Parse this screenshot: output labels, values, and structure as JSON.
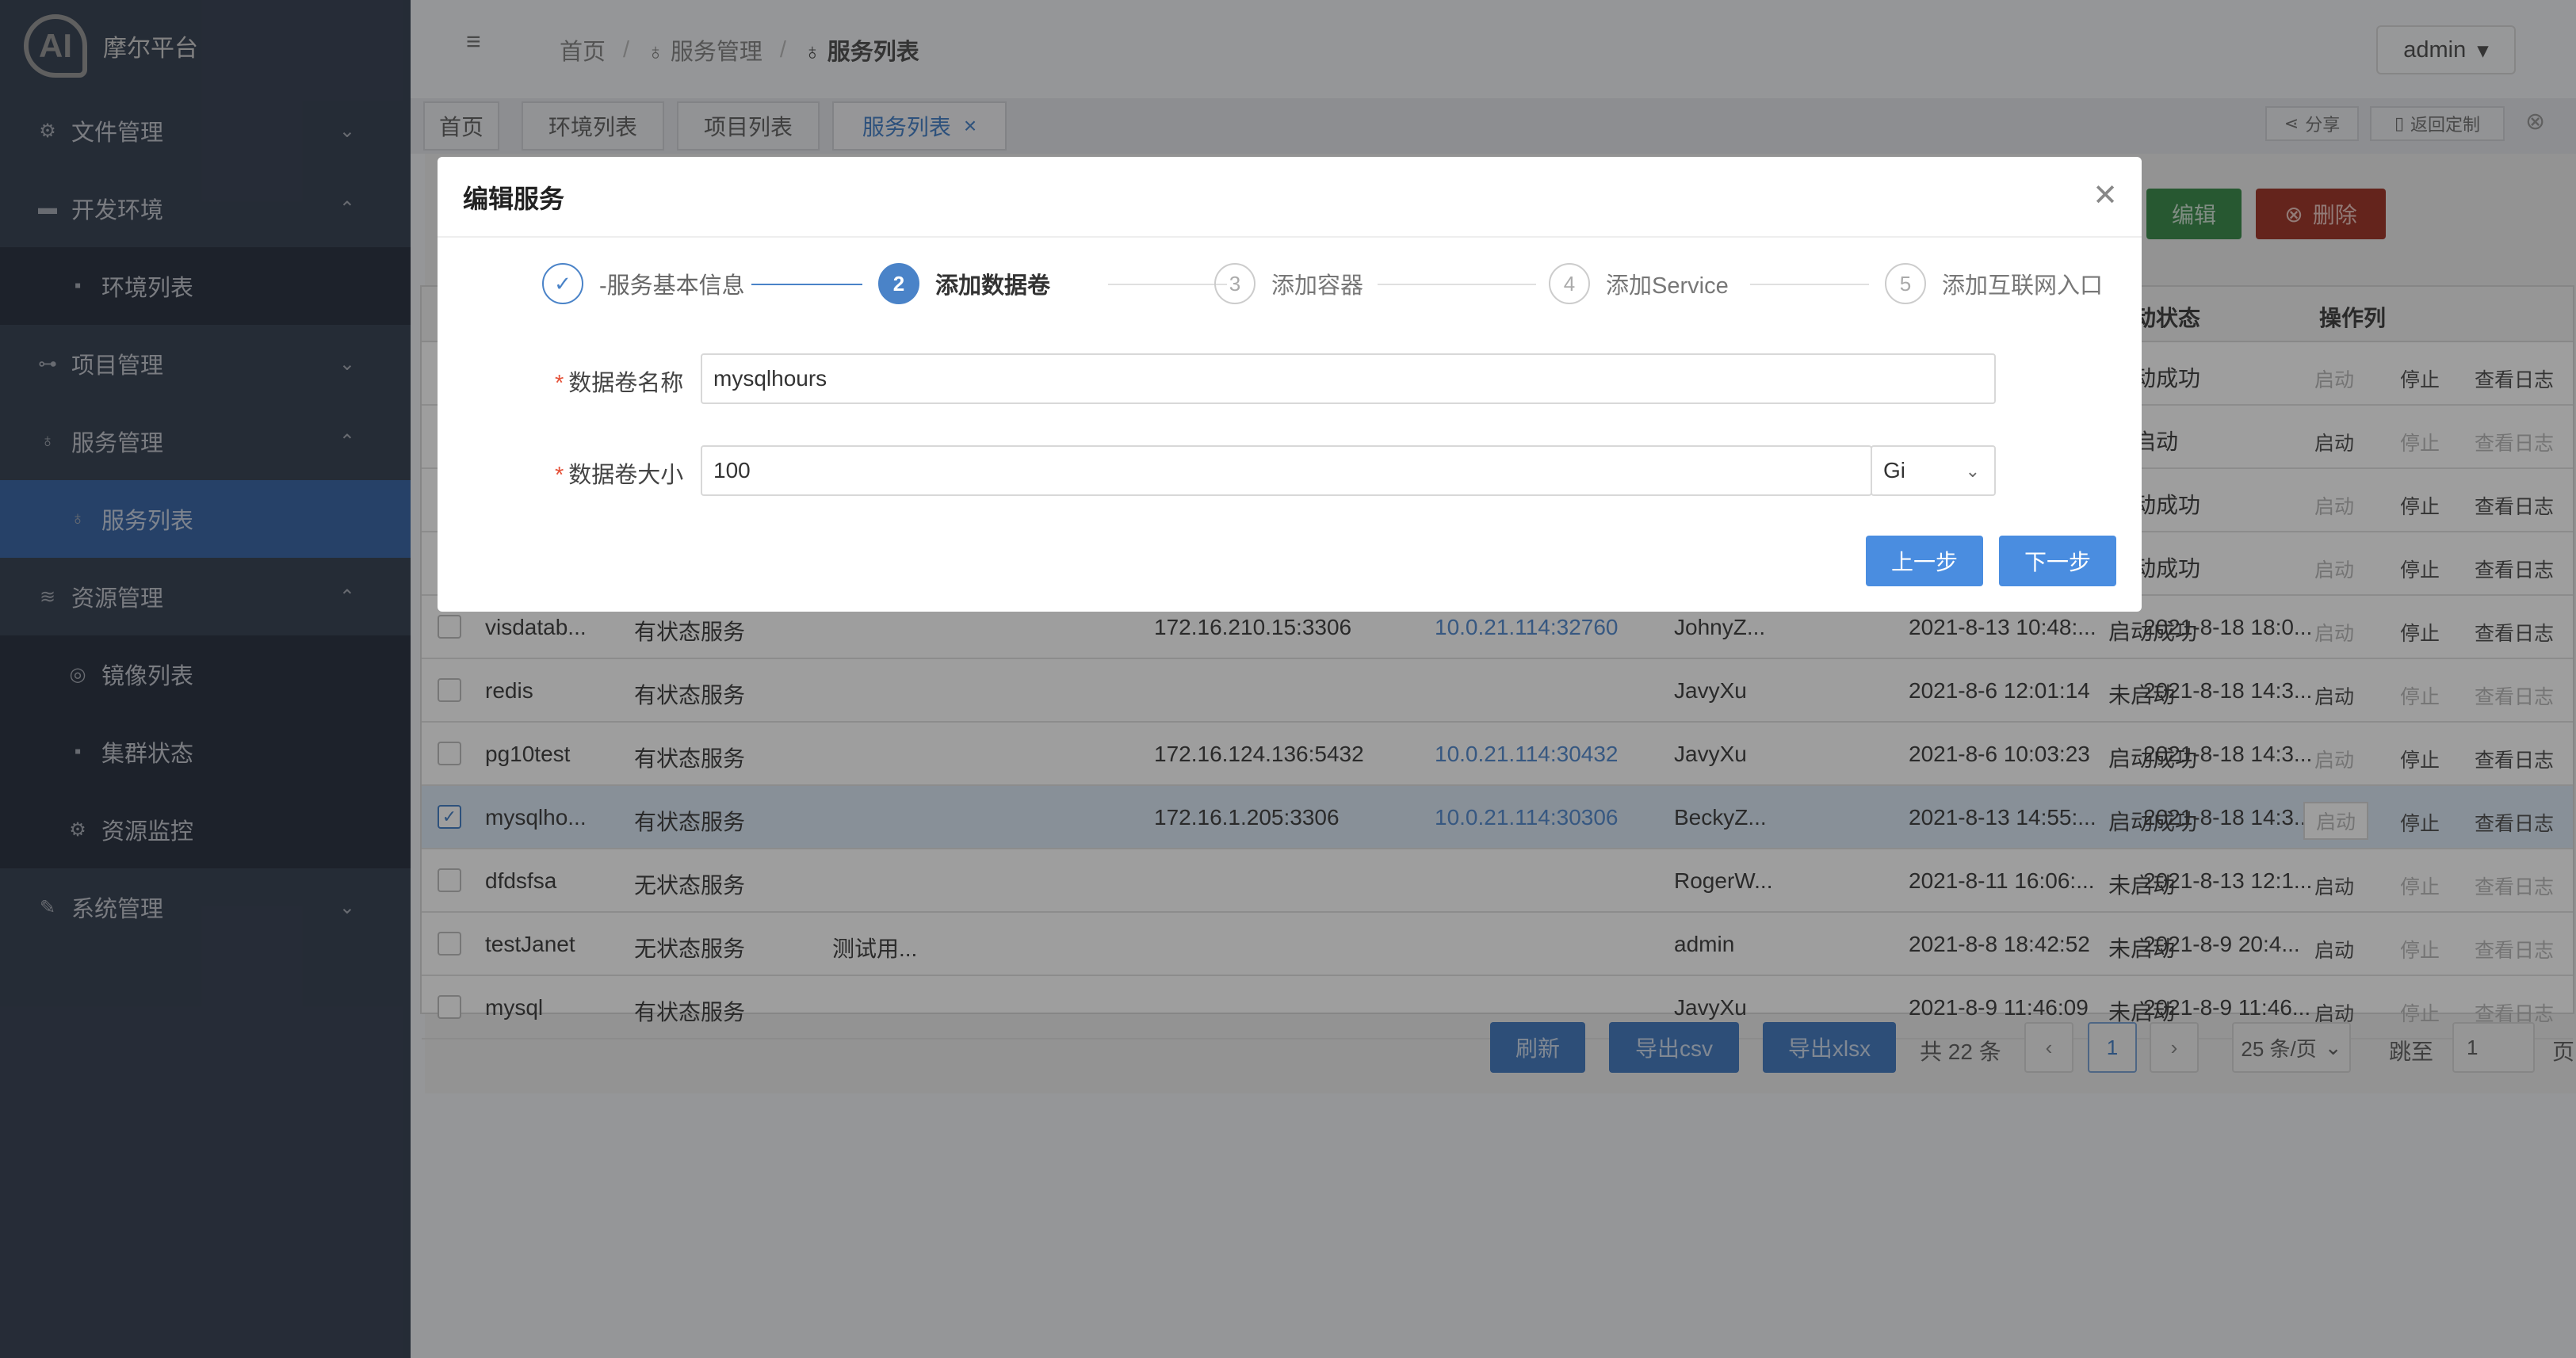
{
  "app": {
    "logo_text": "AI",
    "name": "摩尔平台"
  },
  "sidebar": {
    "items": [
      {
        "label": "文件管理",
        "icon": "gear-icon"
      },
      {
        "label": "开发环境",
        "icon": "box-icon"
      },
      {
        "label": "环境列表",
        "icon": "doc-icon"
      },
      {
        "label": "项目管理",
        "icon": "commit-icon"
      },
      {
        "label": "服务管理",
        "icon": "bulb-icon"
      },
      {
        "label": "服务列表",
        "icon": "bulb-icon"
      },
      {
        "label": "资源管理",
        "icon": "layers-icon"
      },
      {
        "label": "镜像列表",
        "icon": "target-icon"
      },
      {
        "label": "集群状态",
        "icon": "doc-icon"
      },
      {
        "label": "资源监控",
        "icon": "gear-icon"
      },
      {
        "label": "系统管理",
        "icon": "wrench-icon"
      }
    ]
  },
  "header": {
    "breadcrumb": [
      "首页",
      "服务管理",
      "服务列表"
    ],
    "separator": "/",
    "user": "admin"
  },
  "tabs": [
    {
      "label": "首页"
    },
    {
      "label": "环境列表"
    },
    {
      "label": "项目列表"
    },
    {
      "label": "服务列表"
    }
  ],
  "tab_tools": {
    "share": "分享",
    "back": "返回定制"
  },
  "toolbar": {
    "edit": "编辑",
    "delete": "删除"
  },
  "table": {
    "columns": {
      "status": "动状态",
      "ops": "操作列"
    },
    "rows": [
      {
        "name": "",
        "type": "",
        "desc": "",
        "ip": "",
        "ext": "",
        "owner": "",
        "created": "",
        "updated": "",
        "status": "动成功",
        "start_disabled": true
      },
      {
        "name": "",
        "type": "",
        "desc": "",
        "ip": "",
        "ext": "",
        "owner": "",
        "created": "",
        "updated": "",
        "status": "启动",
        "start_disabled": false
      },
      {
        "name": "",
        "type": "",
        "desc": "",
        "ip": "",
        "ext": "",
        "owner": "",
        "created": "",
        "updated": "",
        "status": "动成功",
        "start_disabled": true
      },
      {
        "name": "",
        "type": "",
        "desc": "",
        "ip": "",
        "ext": "",
        "owner": "",
        "created": "",
        "updated": "",
        "status": "动成功",
        "start_disabled": true
      },
      {
        "name": "visdatab...",
        "type": "有状态服务",
        "desc": "",
        "ip": "172.16.210.15:3306",
        "ext": "10.0.21.114:32760",
        "owner": "JohnyZ...",
        "created": "2021-8-13 10:48:...",
        "updated": "2021-8-18 18:0...",
        "status": "启动成功",
        "start_disabled": true
      },
      {
        "name": "redis",
        "type": "有状态服务",
        "desc": "",
        "ip": "",
        "ext": "",
        "owner": "JavyXu",
        "created": "2021-8-6 12:01:14",
        "updated": "2021-8-18 14:3...",
        "status": "未启动",
        "start_disabled": false
      },
      {
        "name": "pg10test",
        "type": "有状态服务",
        "desc": "",
        "ip": "172.16.124.136:5432",
        "ext": "10.0.21.114:30432",
        "owner": "JavyXu",
        "created": "2021-8-6 10:03:23",
        "updated": "2021-8-18 14:3...",
        "status": "启动成功",
        "start_disabled": true
      },
      {
        "name": "mysqlho...",
        "type": "有状态服务",
        "desc": "",
        "ip": "172.16.1.205:3306",
        "ext": "10.0.21.114:30306",
        "owner": "BeckyZ...",
        "created": "2021-8-13 14:55:...",
        "updated": "2021-8-18 14:3...",
        "status": "启动成功",
        "start_disabled": true
      },
      {
        "name": "dfdsfsa",
        "type": "无状态服务",
        "desc": "",
        "ip": "",
        "ext": "",
        "owner": "RogerW...",
        "created": "2021-8-11 16:06:...",
        "updated": "2021-8-13 12:1...",
        "status": "未启动",
        "start_disabled": false
      },
      {
        "name": "testJanet",
        "type": "无状态服务",
        "desc": "测试用...",
        "ip": "",
        "ext": "",
        "owner": "admin",
        "created": "2021-8-8 18:42:52",
        "updated": "2021-8-9 20:4...",
        "status": "未启动",
        "start_disabled": false
      },
      {
        "name": "mysql",
        "type": "有状态服务",
        "desc": "",
        "ip": "",
        "ext": "",
        "owner": "JavyXu",
        "created": "2021-8-9 11:46:09",
        "updated": "2021-8-9 11:46...",
        "status": "未启动",
        "start_disabled": false
      }
    ],
    "ops": {
      "start": "启动",
      "stop": "停止",
      "log": "查看日志"
    }
  },
  "footer": {
    "refresh": "刷新",
    "export_csv": "导出csv",
    "export_xlsx": "导出xlsx",
    "total": "共 22 条",
    "page": "1",
    "page_size": "25 条/页",
    "jump_label": "跳至",
    "jump_value": "1",
    "page_suffix": "页"
  },
  "modal": {
    "title": "编辑服务",
    "steps": [
      {
        "num": "1",
        "label": "-服务基本信息"
      },
      {
        "num": "2",
        "label": "添加数据卷"
      },
      {
        "num": "3",
        "label": "添加容器"
      },
      {
        "num": "4",
        "label": "添加Service"
      },
      {
        "num": "5",
        "label": "添加互联网入口"
      }
    ],
    "fields": {
      "volume_name_label": "数据卷名称",
      "volume_name_value": "mysqlhours",
      "volume_size_label": "数据卷大小",
      "volume_size_value": "100",
      "unit_value": "Gi"
    },
    "prev": "上一步",
    "next": "下一步"
  },
  "colors": {
    "accent": "#4a83c8",
    "edit": "#3f8f4f",
    "delete": "#a23b2e",
    "sidebar": "#3d4758"
  }
}
